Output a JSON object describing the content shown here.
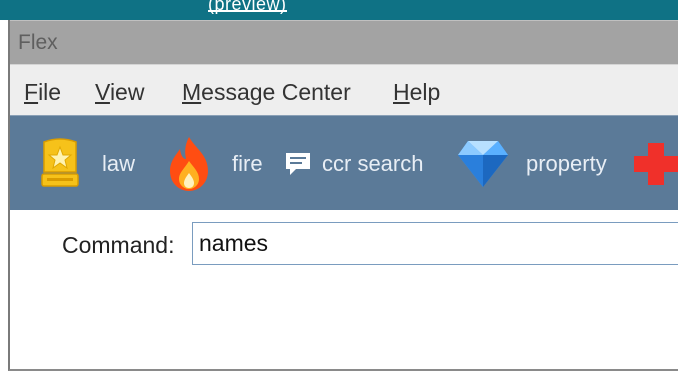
{
  "background_window": {
    "title_fragment": "(preview)"
  },
  "window": {
    "title": "Flex"
  },
  "menu": {
    "file": {
      "mnemonic": "F",
      "rest": "ile"
    },
    "view": {
      "mnemonic": "V",
      "rest": "iew"
    },
    "message_center": {
      "mnemonic": "M",
      "rest": "essage Center"
    },
    "help": {
      "mnemonic": "H",
      "rest": "elp"
    }
  },
  "toolbar": {
    "items": [
      {
        "label": "law",
        "icon": "police-badge-icon",
        "color": "#f2b705"
      },
      {
        "label": "fire",
        "icon": "flame-icon",
        "color": "#ff5a1f"
      },
      {
        "label": "ccr search",
        "icon": "speech-bubble-icon",
        "color": "#ffffff"
      },
      {
        "label": "property",
        "icon": "diamond-icon",
        "color": "#2e8cf0"
      },
      {
        "label": "",
        "icon": "red-cross-icon",
        "color": "#f0302a"
      }
    ]
  },
  "command": {
    "label": "Command:",
    "value": "names"
  },
  "colors": {
    "toolbar_bg": "#5b7a98",
    "titlebar_bg": "#a3a3a3",
    "menubar_bg": "#eeeeee",
    "bg_strip": "#0f7285"
  }
}
